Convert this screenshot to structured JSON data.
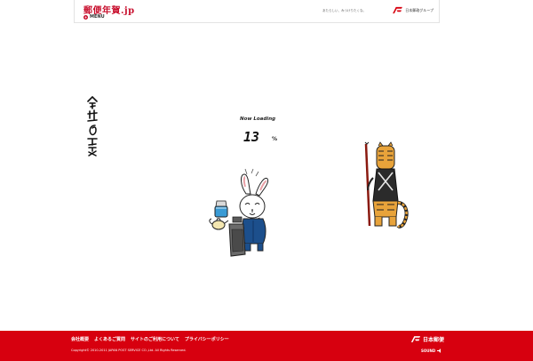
{
  "header": {
    "logo_text": "郵便年賀.jp",
    "menu_label": "MENU",
    "tagline": "あたらしい、みつけりたくな。",
    "group_name": "日本郵政グループ"
  },
  "loading": {
    "label": "Now Loading",
    "percent": "13",
    "percent_sign": "%",
    "progress_value": 13
  },
  "calligraphy": {
    "text": "今年の干支"
  },
  "footer": {
    "links": [
      "会社概要",
      "よくあるご質問",
      "サイトのご利用について",
      "プライバシーポリシー"
    ],
    "copyright": "Copyright© 2010-2011 JAPAN POST SERVICE CO.,Ltd. All Rights Reserved.",
    "brand_name": "日本郵便",
    "sound_label": "SOUND"
  },
  "colors": {
    "accent_red": "#d7000f",
    "logo_red": "#c8102e",
    "background": "#ffffff"
  },
  "icons": [
    "jp-post-logo-icon",
    "menu-dot-icon",
    "sound-icon"
  ]
}
